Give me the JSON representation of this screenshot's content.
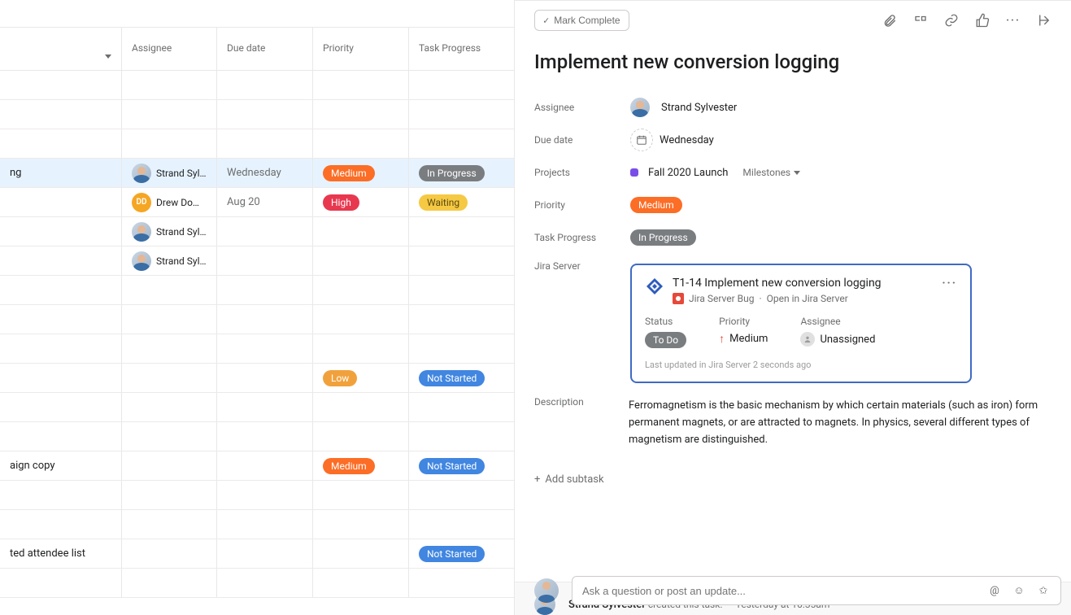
{
  "grid": {
    "columns": {
      "assignee": "Assignee",
      "due": "Due date",
      "priority": "Priority",
      "progress": "Task Progress"
    },
    "rows": [
      {
        "task": "",
        "assignee": "",
        "due": "",
        "priority": "",
        "progress": ""
      },
      {
        "task": "",
        "assignee": "",
        "due": "",
        "priority": "",
        "progress": ""
      },
      {
        "task": "",
        "assignee": "",
        "due": "",
        "priority": "",
        "progress": ""
      },
      {
        "task": "ng",
        "assignee": "Strand Sylv...",
        "avatar": "photo",
        "due": "Wednesday",
        "priority": "Medium",
        "priorityClass": "medium",
        "progress": "In Progress",
        "progressClass": "inprogress",
        "selected": true
      },
      {
        "task": "",
        "assignee": "Drew Domai...",
        "avatar": "dd",
        "avatarText": "DD",
        "due": "Aug 20",
        "priority": "High",
        "priorityClass": "high",
        "progress": "Waiting",
        "progressClass": "waiting"
      },
      {
        "task": "",
        "assignee": "Strand Sylv...",
        "avatar": "photo",
        "due": "",
        "priority": "",
        "progress": ""
      },
      {
        "task": "",
        "assignee": "Strand Sylv...",
        "avatar": "photo",
        "due": "",
        "priority": "",
        "progress": ""
      },
      {
        "task": "",
        "assignee": "",
        "due": "",
        "priority": "",
        "progress": ""
      },
      {
        "task": "",
        "assignee": "",
        "due": "",
        "priority": "",
        "progress": ""
      },
      {
        "task": "",
        "assignee": "",
        "due": "",
        "priority": "",
        "progress": ""
      },
      {
        "task": "",
        "assignee": "",
        "due": "",
        "priority": "Low",
        "priorityClass": "low",
        "progress": "Not Started",
        "progressClass": "notstarted"
      },
      {
        "task": "",
        "assignee": "",
        "due": "",
        "priority": "",
        "progress": ""
      },
      {
        "task": "",
        "assignee": "",
        "due": "",
        "priority": "",
        "progress": ""
      },
      {
        "task": "aign copy",
        "assignee": "",
        "due": "",
        "priority": "Medium",
        "priorityClass": "medium",
        "progress": "Not Started",
        "progressClass": "notstarted"
      },
      {
        "task": "",
        "assignee": "",
        "due": "",
        "priority": "",
        "progress": ""
      },
      {
        "task": "",
        "assignee": "",
        "due": "",
        "priority": "",
        "progress": ""
      },
      {
        "task": "ted attendee list",
        "assignee": "",
        "due": "",
        "priority": "",
        "progress": "Not Started",
        "progressClass": "notstarted"
      },
      {
        "task": "",
        "assignee": "",
        "due": "",
        "priority": "",
        "progress": ""
      }
    ]
  },
  "detail": {
    "markComplete": "Mark Complete",
    "title": "Implement new conversion logging",
    "fields": {
      "assignee": {
        "label": "Assignee",
        "value": "Strand Sylvester"
      },
      "dueDate": {
        "label": "Due date",
        "value": "Wednesday"
      },
      "projects": {
        "label": "Projects",
        "value": "Fall 2020 Launch",
        "milestones": "Milestones"
      },
      "priority": {
        "label": "Priority",
        "value": "Medium"
      },
      "progress": {
        "label": "Task Progress",
        "value": "In Progress"
      },
      "jira": {
        "label": "Jira Server"
      },
      "description": {
        "label": "Description",
        "value": "Ferromagnetism is the basic mechanism by which certain materials (such as iron) form permanent magnets, or are attracted to magnets. In physics, several different types of magnetism are distinguished."
      }
    },
    "jiraCard": {
      "title": "T1-14 Implement new conversion logging",
      "type": "Jira Server Bug",
      "openText": "Open in Jira Server",
      "status": {
        "label": "Status",
        "value": "To Do"
      },
      "priority": {
        "label": "Priority",
        "value": "Medium"
      },
      "assignee": {
        "label": "Assignee",
        "value": "Unassigned"
      },
      "updated": "Last updated in Jira Server 2 seconds ago"
    },
    "addSubtask": "Add subtask",
    "activity": {
      "author": "Strand Sylvester",
      "text": "created this task.",
      "time": "Yesterday at 10:35am"
    },
    "comment": {
      "placeholder": "Ask a question or post an update..."
    }
  }
}
